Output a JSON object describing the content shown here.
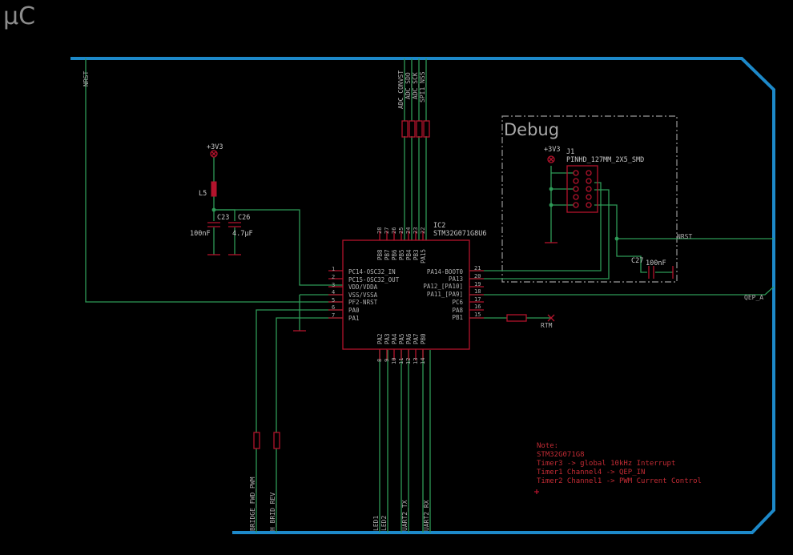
{
  "sheet_title": "μC",
  "debug_group": {
    "title": "Debug"
  },
  "mcu": {
    "reference": "IC2",
    "value": "STM32G071G8U6",
    "left_pins": [
      {
        "num": "1",
        "name": "PC14-OSC32_IN"
      },
      {
        "num": "2",
        "name": "PC15-OSC32_OUT"
      },
      {
        "num": "3",
        "name": "VDD/VDDA"
      },
      {
        "num": "4",
        "name": "VSS/VSSA"
      },
      {
        "num": "5",
        "name": "PF2-NRST"
      },
      {
        "num": "6",
        "name": "PA0"
      },
      {
        "num": "7",
        "name": "PA1"
      }
    ],
    "right_pins": [
      {
        "num": "21",
        "name": "PA14-BOOT0"
      },
      {
        "num": "20",
        "name": "PA13"
      },
      {
        "num": "19",
        "name": "PA12_[PA10]"
      },
      {
        "num": "18",
        "name": "PA11_[PA9]"
      },
      {
        "num": "17",
        "name": "PC6"
      },
      {
        "num": "16",
        "name": "PA8"
      },
      {
        "num": "15",
        "name": "PB1"
      }
    ],
    "top_pins": [
      {
        "num": "28",
        "name": "PB8"
      },
      {
        "num": "27",
        "name": "PB7"
      },
      {
        "num": "26",
        "name": "PB6"
      },
      {
        "num": "25",
        "name": "PB5"
      },
      {
        "num": "24",
        "name": "PB4"
      },
      {
        "num": "23",
        "name": "PB3"
      },
      {
        "num": "22",
        "name": "PA15"
      }
    ],
    "bottom_pins": [
      {
        "num": "8",
        "name": "PA2"
      },
      {
        "num": "9",
        "name": "PA3"
      },
      {
        "num": "10",
        "name": "PA4"
      },
      {
        "num": "11",
        "name": "PA5"
      },
      {
        "num": "12",
        "name": "PA6"
      },
      {
        "num": "13",
        "name": "PA7"
      },
      {
        "num": "14",
        "name": "PB0"
      }
    ]
  },
  "components": {
    "l5": {
      "ref": "L5",
      "power": "+3V3"
    },
    "c23": {
      "ref": "C23",
      "value": "100nF"
    },
    "c26": {
      "ref": "C26",
      "value": "4.7µF"
    },
    "j1": {
      "ref": "J1",
      "value": "PINHD_127MM_2X5_SMD",
      "power": "+3V3"
    },
    "c27": {
      "ref": "C27",
      "value": "100nF"
    }
  },
  "nets": {
    "nrst_top": "NRST",
    "nrst_debug": "NRST",
    "qep_a": "QEP_A",
    "rtm": "RTM",
    "top_labels": [
      "ADC_CONVST",
      "ADC_SDO",
      "ADC_SCK",
      "SPI1_NSS"
    ],
    "bottom_labels": [
      "BRIDGE_FWD_PWM",
      "H_BRID_REV",
      "LED1",
      "LED2",
      "UART2_TX",
      "UART2_RX"
    ]
  },
  "note": {
    "lines": [
      "Note:",
      "STM32G071G8",
      "Timer3 -> global 10kHz Interrupt",
      "Timer1 Channel4 -> QEP_IN",
      "Timer2 Channel1 -> PWM Current Control"
    ]
  }
}
